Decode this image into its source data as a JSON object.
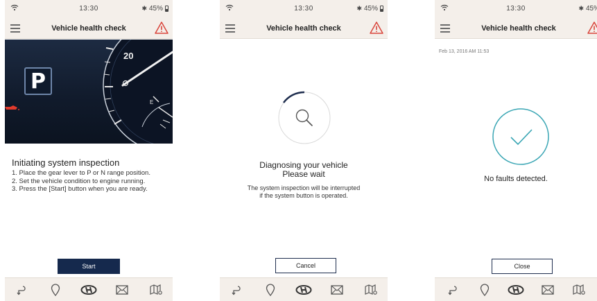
{
  "status": {
    "time": "13:30",
    "battery": "45%"
  },
  "app": {
    "title": "Vehicle health check"
  },
  "screen1": {
    "gear": "P",
    "gauge_number": "20",
    "fuel_letter": "E",
    "heading": "Initiating system inspection",
    "steps": [
      "1. Place the gear lever to P or N range position.",
      "2. Set the vehicle condition to engine running.",
      "3. Press the [Start] button when you are ready."
    ],
    "start_label": "Start"
  },
  "screen2": {
    "title_line1": "Diagnosing your vehicle",
    "title_line2": "Please wait",
    "note_line1": "The system inspection will be interrupted",
    "note_line2": "if the system button is operated.",
    "cancel_label": "Cancel"
  },
  "screen3": {
    "timestamp": "Feb 13, 2016 AM 11:53",
    "result": "No faults detected.",
    "close_label": "Close"
  },
  "nav": [
    "back-icon",
    "location-pin-icon",
    "hyundai-logo-icon",
    "mail-icon",
    "map-icon"
  ],
  "colors": {
    "navy": "#15294d",
    "accent_teal": "#3aa6b4",
    "alert_red": "#d9443a",
    "bar_bg": "#f4efea"
  }
}
